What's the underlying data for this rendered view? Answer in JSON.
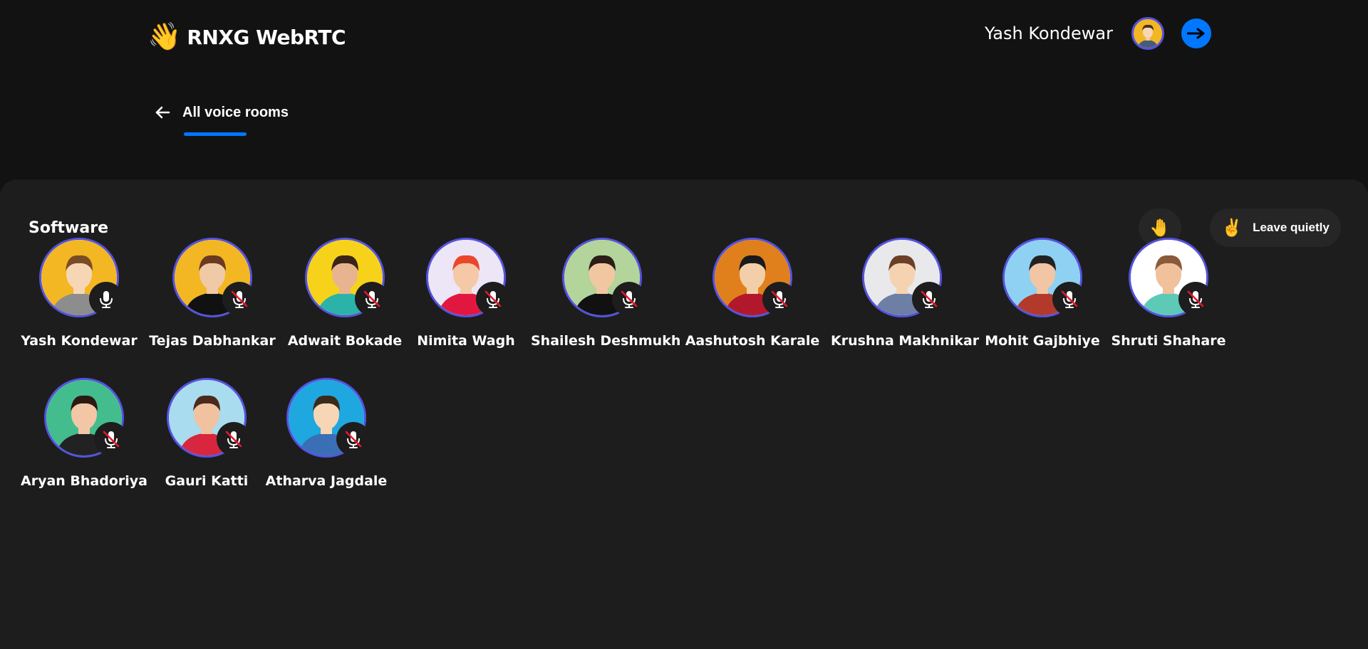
{
  "app": {
    "logo_emoji": "👋",
    "title": "RNXG WebRTC"
  },
  "user": {
    "name": "Yash Kondewar",
    "avatar_icon": "user-avatar-icon",
    "logout_icon": "arrow-right-icon"
  },
  "nav": {
    "back_icon": "arrow-left-icon",
    "label": "All voice rooms"
  },
  "room": {
    "title": "Software",
    "raise_hand_emoji": "🤚",
    "leave_emoji": "✌️",
    "leave_label": "Leave quietly"
  },
  "colors": {
    "accent": "#0077ff",
    "avatar_border": "#5453e0",
    "muted_slash": "#e8172c"
  },
  "members": [
    {
      "name": "Yash Kondewar",
      "muted": false,
      "bg": "#f3b723"
    },
    {
      "name": "Tejas Dabhankar",
      "muted": true,
      "bg": "#f3b723"
    },
    {
      "name": "Adwait Bokade",
      "muted": true,
      "bg": "#f7d21b"
    },
    {
      "name": "Nimita Wagh",
      "muted": true,
      "bg": "#ece6f6"
    },
    {
      "name": "Shailesh Deshmukh",
      "muted": true,
      "bg": "#b3d49a"
    },
    {
      "name": "Aashutosh Karale",
      "muted": true,
      "bg": "#e0801c"
    },
    {
      "name": "Krushna Makhnikar",
      "muted": true,
      "bg": "#e9e9ec"
    },
    {
      "name": "Mohit Gajbhiye",
      "muted": true,
      "bg": "#8fd1f3"
    },
    {
      "name": "Shruti Shahare",
      "muted": true,
      "bg": "#ffffff"
    },
    {
      "name": "Aryan Bhadoriya",
      "muted": true,
      "bg": "#43bd8e"
    },
    {
      "name": "Gauri Katti",
      "muted": true,
      "bg": "#a9dcee"
    },
    {
      "name": "Atharva Jagdale",
      "muted": true,
      "bg": "#1fa8e0"
    }
  ]
}
